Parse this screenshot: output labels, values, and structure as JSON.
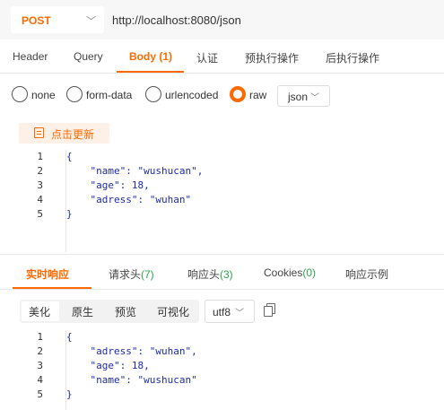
{
  "request": {
    "method": "POST",
    "url": "http://localhost:8080/json"
  },
  "request_tabs": [
    {
      "label": "Header"
    },
    {
      "label": "Query"
    },
    {
      "label": "Body",
      "count": "(1)"
    },
    {
      "label": "认证"
    },
    {
      "label": "预执行操作"
    },
    {
      "label": "后执行操作"
    }
  ],
  "active_request_tab": "Body",
  "body_types": [
    "none",
    "form-data",
    "urlencoded",
    "raw"
  ],
  "selected_body_type": "raw",
  "body_format": "json",
  "update_button": "点击更新",
  "request_body": {
    "line_numbers": [
      "1",
      "2",
      "3",
      "4",
      "5"
    ],
    "lines": [
      "{",
      "    \"name\": \"wushucan\",",
      "    \"age\": 18,",
      "    \"adress\": \"wuhan\"",
      "}"
    ]
  },
  "response_tabs": [
    {
      "label": "实时响应"
    },
    {
      "label": "请求头",
      "count": "(7)"
    },
    {
      "label": "响应头",
      "count": "(3)"
    },
    {
      "label": "Cookies",
      "count": "(0)"
    },
    {
      "label": "响应示例"
    }
  ],
  "active_response_tab": "实时响应",
  "view_modes": [
    "美化",
    "原生",
    "预览",
    "可视化"
  ],
  "active_view_mode": "美化",
  "encoding": "utf8",
  "response_body": {
    "line_numbers": [
      "1",
      "2",
      "3",
      "4",
      "5"
    ],
    "lines": [
      "{",
      "    \"adress\": \"wuhan\",",
      "    \"age\": 18,",
      "    \"name\": \"wushucan\"",
      "}"
    ]
  },
  "colors": {
    "accent": "#ff6a00",
    "count_green": "#2ea44f",
    "json_string": "#1f2aa8"
  },
  "icons": [
    "chevron-down-icon",
    "document-icon",
    "copy-icon"
  ]
}
